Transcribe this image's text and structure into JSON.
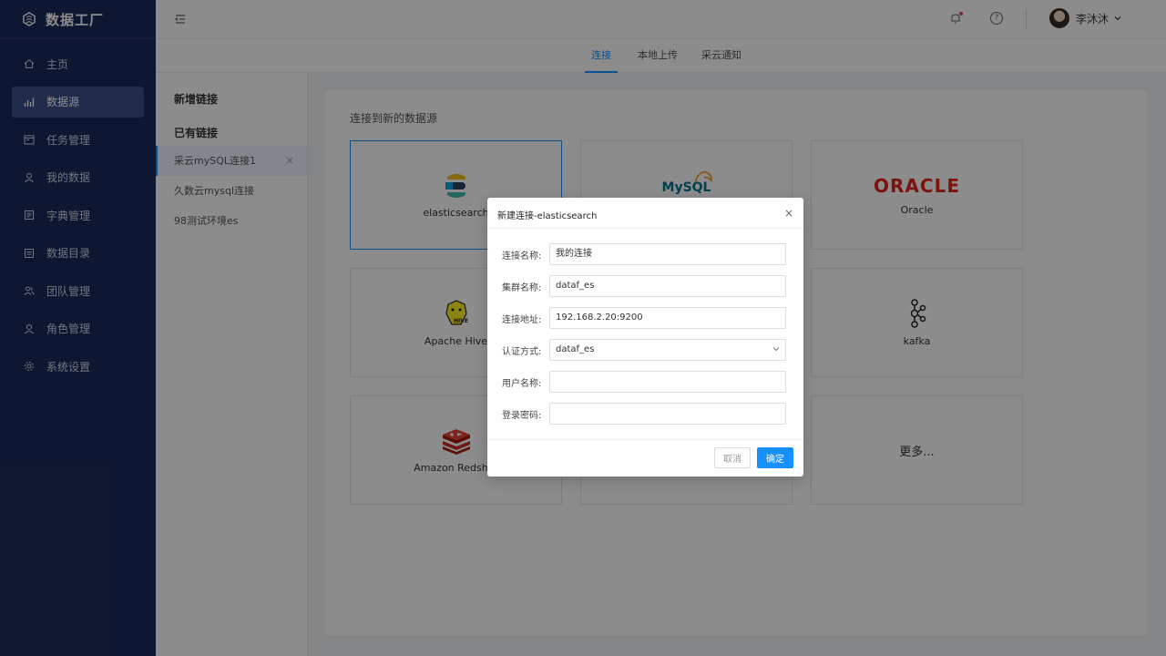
{
  "app": {
    "title": "数据工厂"
  },
  "sidebar": {
    "items": [
      {
        "label": "主页",
        "icon": "home-icon"
      },
      {
        "label": "数据源",
        "icon": "chart-bars-icon"
      },
      {
        "label": "任务管理",
        "icon": "calendar-icon"
      },
      {
        "label": "我的数据",
        "icon": "user-icon"
      },
      {
        "label": "字典管理",
        "icon": "book-icon"
      },
      {
        "label": "数据目录",
        "icon": "folder-icon"
      },
      {
        "label": "团队管理",
        "icon": "team-icon"
      },
      {
        "label": "角色管理",
        "icon": "role-icon"
      },
      {
        "label": "系统设置",
        "icon": "gear-icon"
      }
    ],
    "active_index": 1
  },
  "header": {
    "user_name": "李沐沐",
    "help_glyph": "?"
  },
  "tabs": [
    {
      "label": "连接"
    },
    {
      "label": "本地上传"
    },
    {
      "label": "采云通知"
    }
  ],
  "left_panel": {
    "new_link": "新增链接",
    "existing_links": "已有链接",
    "links": [
      {
        "label": "采云mySQL连接1"
      },
      {
        "label": "久数云mysql连接"
      },
      {
        "label": "98测试环境es"
      }
    ]
  },
  "content": {
    "title": "连接到新的数据源",
    "cards": [
      {
        "label": "elasticsearch"
      },
      {
        "label": ""
      },
      {
        "label": "Oracle"
      },
      {
        "label": "Apache Hive"
      },
      {
        "label": ""
      },
      {
        "label": "kafka"
      },
      {
        "label": "Amazon Redshift"
      },
      {
        "label": ""
      },
      {
        "label": "更多..."
      }
    ],
    "logo_text": {
      "mysql": "MySQL",
      "oracle": "ORACLE",
      "hive": "HIVE"
    }
  },
  "modal": {
    "title": "新建连接-elasticsearch",
    "close_glyph": "×",
    "fields": [
      {
        "label": "连接名称:",
        "value": "我的连接"
      },
      {
        "label": "集群名称:",
        "value": "dataf_es"
      },
      {
        "label": "连接地址:",
        "value": "192.168.2.20:9200"
      },
      {
        "label": "认证方式:",
        "value": "dataf_es"
      },
      {
        "label": "用户名称:",
        "value": ""
      },
      {
        "label": "登录密码:",
        "value": ""
      }
    ],
    "cancel_label": "取消",
    "ok_label": "确定"
  },
  "colors": {
    "sidebar_bg": "#1b2a5a",
    "accent": "#1890ff",
    "oracle_red": "#e2231a"
  }
}
